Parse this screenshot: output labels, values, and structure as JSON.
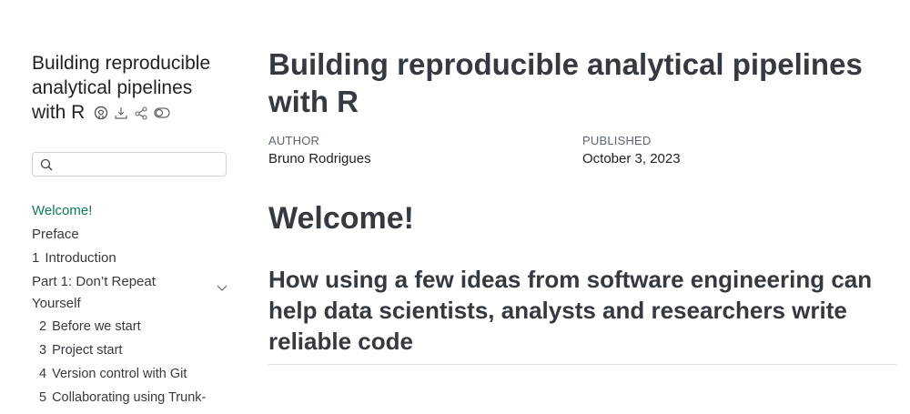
{
  "sidebar": {
    "book_title": "Building reproducible analytical pipelines with R",
    "search": {
      "value": "",
      "placeholder": ""
    },
    "items": [
      {
        "label": "Welcome!",
        "active": true
      },
      {
        "label": "Preface"
      },
      {
        "num": "1",
        "label": "Introduction"
      }
    ],
    "section": {
      "label": "Part 1: Don’t Repeat Yourself"
    },
    "sub_items": [
      {
        "num": "2",
        "label": "Before we start"
      },
      {
        "num": "3",
        "label": "Project start"
      },
      {
        "num": "4",
        "label": "Version control with Git"
      },
      {
        "num": "5",
        "label": "Collaborating using Trunk-"
      }
    ]
  },
  "main": {
    "title": "Building reproducible analytical pipelines with R",
    "meta": {
      "author_label": "AUTHOR",
      "author": "Bruno Rodrigues",
      "published_label": "PUBLISHED",
      "published": "October 3, 2023"
    },
    "heading": "Welcome!",
    "subtitle": "How using a few ideas from software engineering can help data scientists, analysts and researchers write reliable code"
  },
  "colors": {
    "accent": "#127a5e",
    "text": "#343a40"
  },
  "icons": [
    "github-icon",
    "download-icon",
    "share-icon",
    "reader-mode-icon",
    "search-icon",
    "chevron-down-icon"
  ]
}
